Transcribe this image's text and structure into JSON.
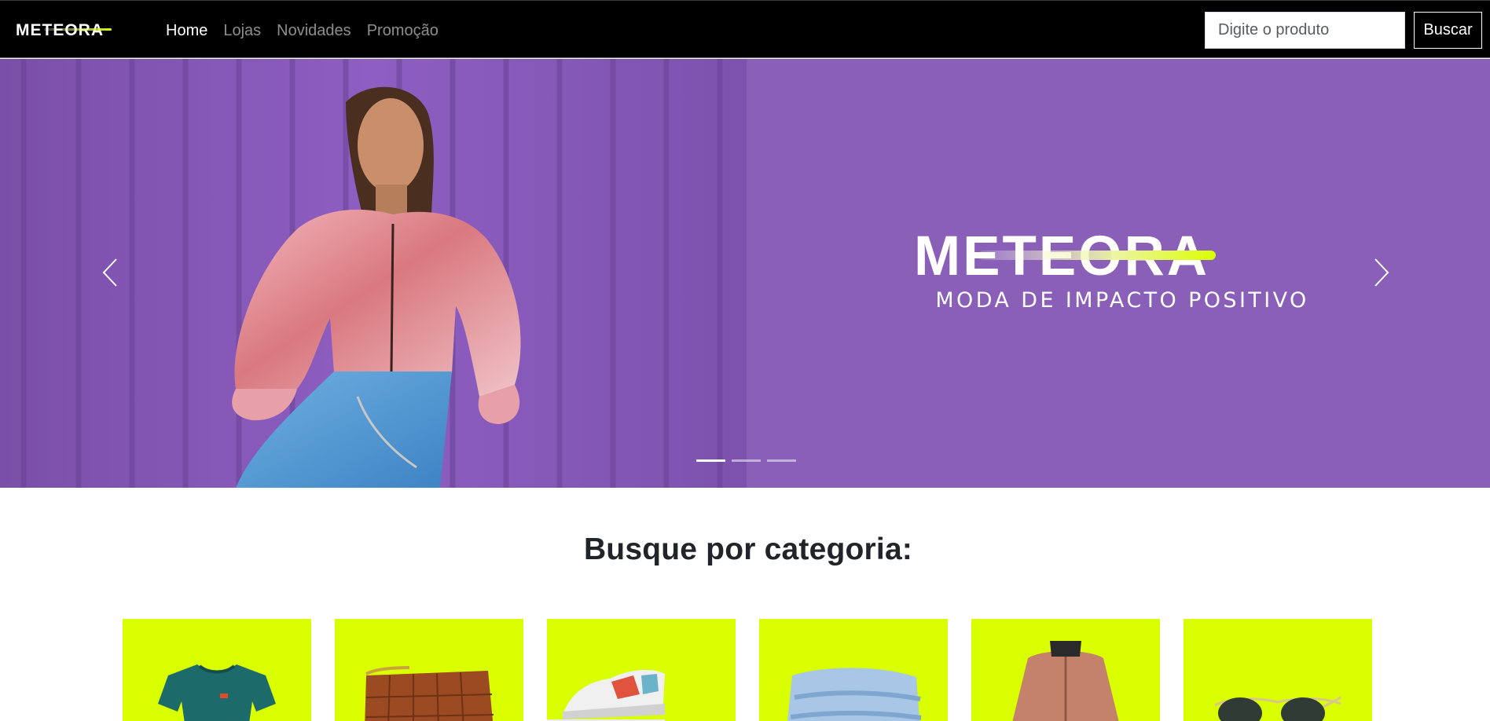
{
  "brand": {
    "name": "METEORA"
  },
  "nav": {
    "links": [
      {
        "label": "Home",
        "active": true
      },
      {
        "label": "Lojas",
        "active": false
      },
      {
        "label": "Novidades",
        "active": false
      },
      {
        "label": "Promoção",
        "active": false
      }
    ]
  },
  "search": {
    "placeholder": "Digite o produto",
    "value": "",
    "button_label": "Buscar"
  },
  "hero": {
    "tagline": "MODA DE IMPACTO POSITIVO",
    "prev_icon": "chevron-left-icon",
    "next_icon": "chevron-right-icon",
    "slide_count": 3,
    "active_slide": 1
  },
  "category_section": {
    "title": "Busque por categoria:",
    "cards": [
      {
        "name": "t-shirt"
      },
      {
        "name": "bag"
      },
      {
        "name": "sneaker"
      },
      {
        "name": "jeans"
      },
      {
        "name": "jacket"
      },
      {
        "name": "sunglasses"
      }
    ]
  },
  "colors": {
    "navbar_bg": "#000000",
    "hero_bg": "#8a5fb8",
    "accent": "#d9ff00",
    "text": "#212529"
  }
}
